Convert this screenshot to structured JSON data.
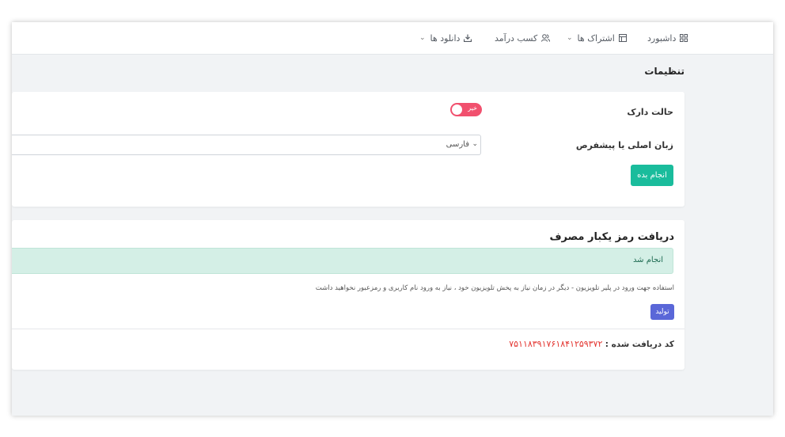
{
  "nav": {
    "items": [
      {
        "label": "داشبورد",
        "icon": "dashboard-icon",
        "dropdown": false
      },
      {
        "label": "اشتراک ها",
        "icon": "subscription-icon",
        "dropdown": true
      },
      {
        "label": "کسب درآمد",
        "icon": "users-icon",
        "dropdown": false
      },
      {
        "label": "دانلود ها",
        "icon": "download-icon",
        "dropdown": true
      }
    ]
  },
  "page": {
    "title": "تنظیمات"
  },
  "settings": {
    "dark_mode_label": "حالت دارک",
    "dark_mode_value": "خیر",
    "language_label": "زبان اصلی یا پیشفرص",
    "language_value": "فارسی",
    "save_label": "انجام بده"
  },
  "otp": {
    "title": "دریافت رمز یکبار مصرف",
    "alert": "انجام شد",
    "description": "استفاده جهت ورود در پلیر تلویزیون - دیگر در زمان نیاز به پخش تلویزیون خود ، نیاز به ورود نام کاربری و رمزعبور نخواهید داشت",
    "generate_label": "تولید",
    "received_label": "کد دریافت شده :",
    "received_code": "۷۵۱۱۸۳۹۱۷۶۱۸۴۱۲۵۹۳۷۲"
  },
  "colors": {
    "toggle_off": "#f1506e",
    "save_button": "#1abc9c",
    "generate_button": "#5a67d8",
    "alert_bg": "#d4efe6",
    "code_text": "#e3342f"
  }
}
